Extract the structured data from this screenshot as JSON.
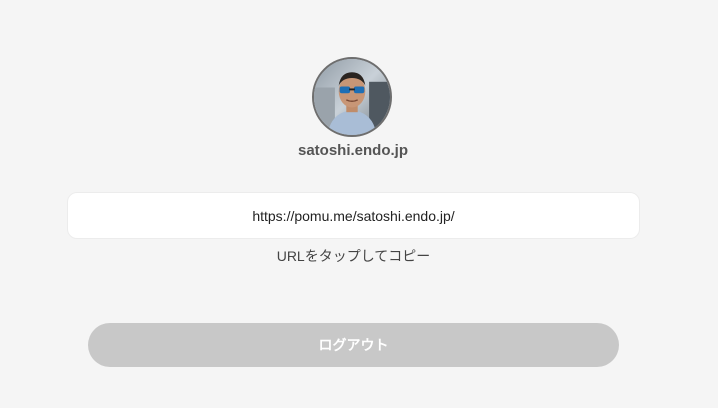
{
  "profile": {
    "avatar_icon": "user-photo",
    "username": "satoshi.endo.jp"
  },
  "share": {
    "url": "https://pomu.me/satoshi.endo.jp/",
    "hint": "URLをタップしてコピー"
  },
  "actions": {
    "logout_label": "ログアウト",
    "logout_color": "#c8c8c8"
  },
  "colors": {
    "background": "#f5f5f5",
    "card": "#ffffff"
  }
}
